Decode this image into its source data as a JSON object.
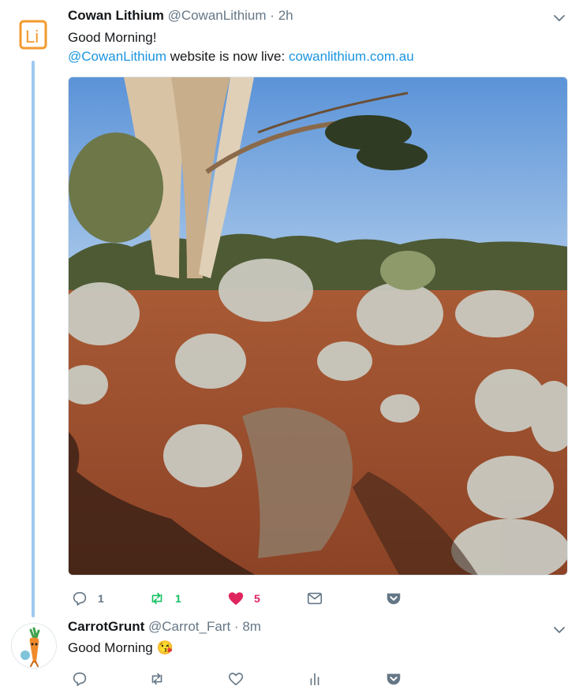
{
  "tweets": [
    {
      "author_name": "Cowan Lithium",
      "author_handle": "@CowanLithium",
      "separator": "·",
      "time": "2h",
      "avatar_text": "Li",
      "text_line1": "Good Morning!",
      "mention": "@CowanLithium",
      "text_mid": " website is now live: ",
      "url": "cowanlithium.com.au",
      "media_icon": "outback-landscape-photo",
      "replies": "1",
      "retweets": "1",
      "likes": "5",
      "liked": true,
      "retweeted": true
    },
    {
      "author_name": "CarrotGrunt",
      "author_handle": "@Carrot_Fart",
      "separator": "·",
      "time": "8m",
      "text": "Good Morning ",
      "emoji": "😘"
    }
  ],
  "colors": {
    "link": "#1b95e0",
    "retweet": "#17bf63",
    "like": "#e0245e",
    "thread_line": "#9ec9f0",
    "brand_orange": "#f39a2e"
  }
}
